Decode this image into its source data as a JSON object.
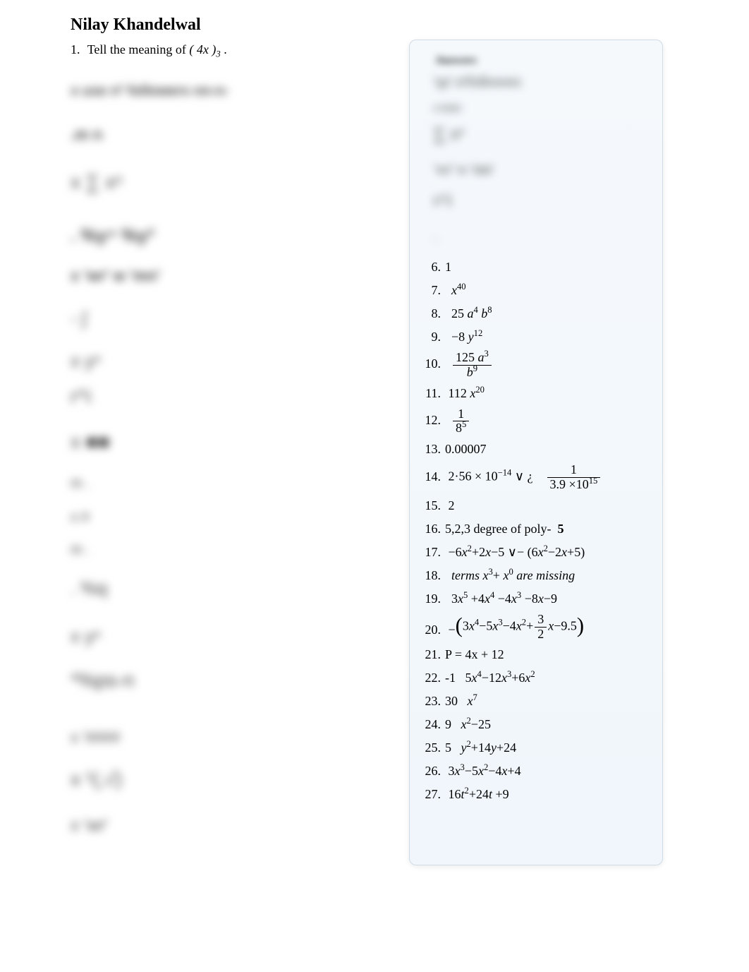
{
  "header": {
    "author": "Nilay Khandelwal"
  },
  "question": {
    "number": "1.",
    "text": "Tell the meaning of"
  },
  "answers_title": "Answers",
  "blurred_left": {
    "b1": "x  use  n² followers  nn-n-",
    "b2": ".m  n",
    "b3": "x  ∑ xⁿ",
    "b4": ". %y⁴  %y³",
    "b5": "x  'wr'  w  'mn'",
    "b6": "-  ∫",
    "b7": "x  yⁿ",
    "b8": "r^i",
    "b9": "x  ■■",
    "b10": "m .",
    "b11": "x  #",
    "b12": "m .",
    "b13": ". %q",
    "b14": "x  yⁿ",
    "b15": "*%ps-n",
    "b16": "x  '####",
    "b17": "x ¹(,√)",
    "b18": "x  'wr'"
  },
  "blurred_answers": {
    "a1": "'qx' n²followers",
    "a1b": "# ####",
    "a2": "∑ xⁿ",
    "a3": "'wr'  w  'mn'",
    "a4": "r^i",
    "a5": "."
  },
  "answers": {
    "6": {
      "n": "6.",
      "v": "1"
    },
    "7": {
      "n": "7.",
      "base": "x",
      "exp": "40"
    },
    "8": {
      "n": "8.",
      "v": "25",
      "a_exp": "4",
      "b_exp": "8"
    },
    "9": {
      "n": "9.",
      "coef": "−8",
      "y_exp": "12"
    },
    "10": {
      "n": "10.",
      "num_coef": "125",
      "a_exp": "3",
      "den_base": "b",
      "den_exp": "9"
    },
    "11": {
      "n": "11.",
      "coef": "112",
      "x_exp": "20"
    },
    "12": {
      "n": "12.",
      "num": "1",
      "den_base": "8",
      "den_exp": "5"
    },
    "13": {
      "n": "13.",
      "v": "0.00007"
    },
    "14": {
      "n": "14.",
      "mant": "2·56 ×",
      "pow_base": "10",
      "pow": "−14",
      "or": "∨ ¿",
      "r_num": "1",
      "r_den_coef": "3.9 ×",
      "r_den_base": "10",
      "r_den_exp": "15"
    },
    "15": {
      "n": "15.",
      "v": "2"
    },
    "16": {
      "n": "16.",
      "pre": "5,2,3  degree of poly-",
      "deg": "5"
    },
    "17": {
      "n": "17.",
      "poly1_a": "−6",
      "poly1_b": "2",
      "poly1_c": "5",
      "mid": "∨−",
      "poly2_a": "6",
      "poly2_b": "2",
      "poly2_c": "5"
    },
    "18": {
      "n": "18.",
      "txt1": "terms",
      "exp1": "3",
      "exp2": "0",
      "txt2": "are missing"
    },
    "19": {
      "n": "19.",
      "c0": "3",
      "e0": "5",
      "s1": "+",
      "c1": "4",
      "e1": "4",
      "s2": "−",
      "c2": "4",
      "e2": "3",
      "s3": "−",
      "c3": "8",
      "const": "9"
    },
    "20": {
      "n": "20.",
      "sign": "−",
      "c0": "3",
      "e0": "4",
      "c1": "5",
      "e1": "3",
      "c2": "4",
      "e2": "2",
      "frac_n": "3",
      "frac_d": "2",
      "const": "9.5"
    },
    "21": {
      "n": "21.",
      "v": "P = 4x + 12"
    },
    "22": {
      "n": "22.",
      "pre": "-1",
      "c0": "5",
      "e0": "4",
      "c1": "12",
      "e1": "3",
      "c2": "6",
      "e2": "2"
    },
    "23": {
      "n": "23.",
      "pre": "30",
      "exp": "7"
    },
    "24": {
      "n": "24.",
      "pre": "9",
      "exp": "2",
      "c": "25"
    },
    "25": {
      "n": "25.",
      "pre": "5",
      "exp": "2",
      "c1": "14",
      "c2": "24"
    },
    "26": {
      "n": "26.",
      "c0": "3",
      "e0": "3",
      "c1": "5",
      "e1": "2",
      "c2": "4",
      "c3": "4"
    },
    "27": {
      "n": "27.",
      "c0": "16",
      "e0": "2",
      "c1": "24",
      "c2": "9"
    }
  }
}
